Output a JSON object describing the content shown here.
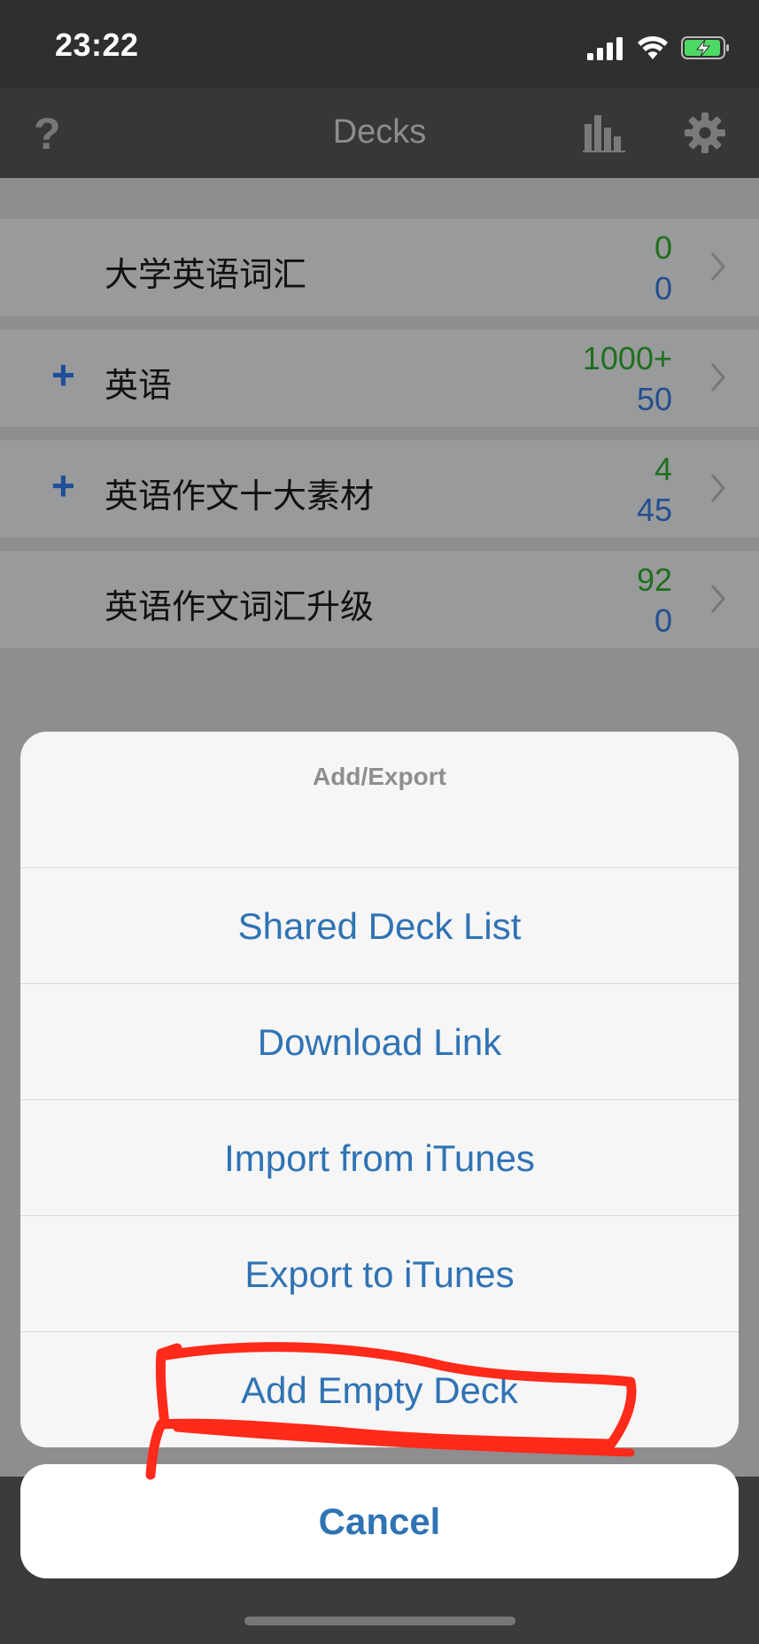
{
  "status_bar": {
    "time": "23:22"
  },
  "nav": {
    "title": "Decks",
    "help": "?"
  },
  "decks": [
    {
      "name": "大学英语词汇",
      "has_children": false,
      "new_count": "0",
      "review_count": "0"
    },
    {
      "name": "英语",
      "has_children": true,
      "new_count": "1000+",
      "review_count": "50"
    },
    {
      "name": "英语作文十大素材",
      "has_children": true,
      "new_count": "4",
      "review_count": "45"
    },
    {
      "name": "英语作文词汇升级",
      "has_children": false,
      "new_count": "92",
      "review_count": "0"
    }
  ],
  "action_sheet": {
    "title": "Add/Export",
    "items": [
      "Shared Deck List",
      "Download Link",
      "Import from iTunes",
      "Export to iTunes",
      "Add Empty Deck"
    ],
    "cancel": "Cancel"
  },
  "colors": {
    "accent": "#2f73b4",
    "new_count": "#1f6f1f",
    "review_count": "#234f8f",
    "annotation": "#ff2a1a"
  },
  "annotation": {
    "highlighted_item": "Add Empty Deck"
  }
}
